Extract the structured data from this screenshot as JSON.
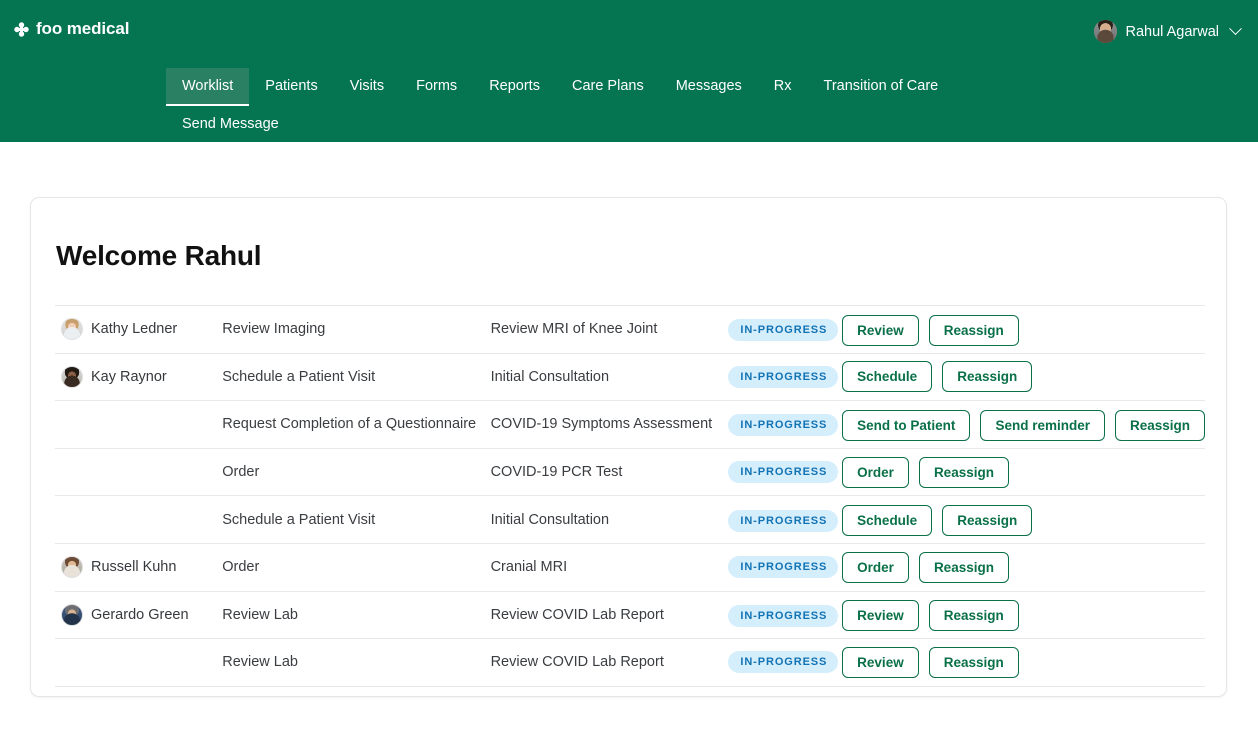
{
  "header": {
    "brand": "foo medical",
    "brand_icon": "clover-cross-icon",
    "user": {
      "name": "Rahul Agarwal",
      "avatar_icon": "user-avatar",
      "chevron_icon": "chevron-down-icon"
    },
    "nav": [
      {
        "label": "Worklist",
        "active": true
      },
      {
        "label": "Patients",
        "active": false
      },
      {
        "label": "Visits",
        "active": false
      },
      {
        "label": "Forms",
        "active": false
      },
      {
        "label": "Reports",
        "active": false
      },
      {
        "label": "Care Plans",
        "active": false
      },
      {
        "label": "Messages",
        "active": false
      },
      {
        "label": "Rx",
        "active": false
      },
      {
        "label": "Transition of Care",
        "active": false
      },
      {
        "label": "Send Message",
        "active": false
      }
    ]
  },
  "colors": {
    "header_green": "#057450",
    "active_tab_green": "#2a8063",
    "button_green": "#0a7048",
    "badge_bg": "#d5eefb",
    "badge_text": "#1273b5"
  },
  "card": {
    "title": "Welcome Rahul",
    "rows": [
      {
        "patient": "Kathy Ledner",
        "avatar": "avatar-kathy-ledner",
        "task": "Review Imaging",
        "description": "Review MRI of Knee Joint",
        "status": "IN-PROGRESS",
        "actions": [
          "Review",
          "Reassign"
        ]
      },
      {
        "patient": "Kay Raynor",
        "avatar": "avatar-kay-raynor",
        "task": "Schedule a Patient Visit",
        "description": "Initial Consultation",
        "status": "IN-PROGRESS",
        "actions": [
          "Schedule",
          "Reassign"
        ]
      },
      {
        "patient": "",
        "avatar": "",
        "task": "Request Completion of a Questionnaire",
        "description": "COVID-19 Symptoms Assessment",
        "status": "IN-PROGRESS",
        "actions": [
          "Send to Patient",
          "Send reminder",
          "Reassign"
        ]
      },
      {
        "patient": "",
        "avatar": "",
        "task": "Order",
        "description": "COVID-19 PCR Test",
        "status": "IN-PROGRESS",
        "actions": [
          "Order",
          "Reassign"
        ]
      },
      {
        "patient": "",
        "avatar": "",
        "task": "Schedule a Patient Visit",
        "description": "Initial Consultation",
        "status": "IN-PROGRESS",
        "actions": [
          "Schedule",
          "Reassign"
        ]
      },
      {
        "patient": "Russell Kuhn",
        "avatar": "avatar-russell-kuhn",
        "task": "Order",
        "description": "Cranial MRI",
        "status": "IN-PROGRESS",
        "actions": [
          "Order",
          "Reassign"
        ]
      },
      {
        "patient": "Gerardo Green",
        "avatar": "avatar-gerardo-green",
        "task": "Review Lab",
        "description": "Review COVID Lab Report",
        "status": "IN-PROGRESS",
        "actions": [
          "Review",
          "Reassign"
        ]
      },
      {
        "patient": "",
        "avatar": "",
        "task": "Review Lab",
        "description": "Review COVID Lab Report",
        "status": "IN-PROGRESS",
        "actions": [
          "Review",
          "Reassign"
        ]
      }
    ]
  }
}
